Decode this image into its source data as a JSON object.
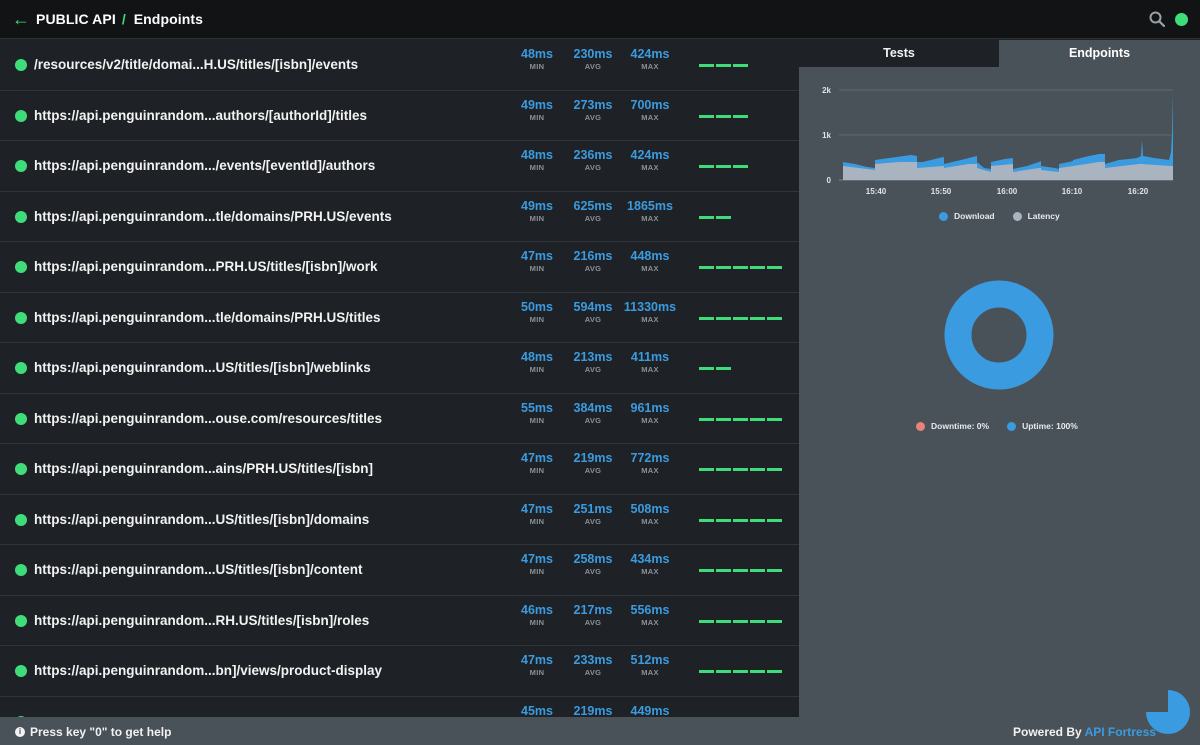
{
  "header": {
    "breadcrumb_root": "PUBLIC API",
    "separator": "/",
    "breadcrumb_current": "Endpoints"
  },
  "metric_labels": {
    "min": "MIN",
    "avg": "AVG",
    "max": "MAX",
    "unit": "ms"
  },
  "endpoints": [
    {
      "url": "/resources/v2/title/domai...H.US/titles/[isbn]/events",
      "min": "48",
      "avg": "230",
      "max": "424",
      "bars": 3
    },
    {
      "url": "https://api.penguinrandom...authors/[authorId]/titles",
      "min": "49",
      "avg": "273",
      "max": "700",
      "bars": 3
    },
    {
      "url": "https://api.penguinrandom.../events/[eventId]/authors",
      "min": "48",
      "avg": "236",
      "max": "424",
      "bars": 3
    },
    {
      "url": "https://api.penguinrandom...tle/domains/PRH.US/events",
      "min": "49",
      "avg": "625",
      "max": "1865",
      "bars": 2
    },
    {
      "url": "https://api.penguinrandom...PRH.US/titles/[isbn]/work",
      "min": "47",
      "avg": "216",
      "max": "448",
      "bars": 5
    },
    {
      "url": "https://api.penguinrandom...tle/domains/PRH.US/titles",
      "min": "50",
      "avg": "594",
      "max": "11330",
      "bars": 5
    },
    {
      "url": "https://api.penguinrandom...US/titles/[isbn]/weblinks",
      "min": "48",
      "avg": "213",
      "max": "411",
      "bars": 2
    },
    {
      "url": "https://api.penguinrandom...ouse.com/resources/titles",
      "min": "55",
      "avg": "384",
      "max": "961",
      "bars": 5
    },
    {
      "url": "https://api.penguinrandom...ains/PRH.US/titles/[isbn]",
      "min": "47",
      "avg": "219",
      "max": "772",
      "bars": 5
    },
    {
      "url": "https://api.penguinrandom...US/titles/[isbn]/domains",
      "min": "47",
      "avg": "251",
      "max": "508",
      "bars": 5
    },
    {
      "url": "https://api.penguinrandom...US/titles/[isbn]/content",
      "min": "47",
      "avg": "258",
      "max": "434",
      "bars": 5
    },
    {
      "url": "https://api.penguinrandom...RH.US/titles/[isbn]/roles",
      "min": "46",
      "avg": "217",
      "max": "556",
      "bars": 5
    },
    {
      "url": "https://api.penguinrandom...bn]/views/product-display",
      "min": "47",
      "avg": "233",
      "max": "512",
      "bars": 5
    },
    {
      "url": "",
      "min": "45",
      "avg": "219",
      "max": "449",
      "bars": 0
    }
  ],
  "tabs": {
    "tests": "Tests",
    "endpoints": "Endpoints",
    "active": "Endpoints"
  },
  "chart_data": [
    {
      "type": "area",
      "y_ticks": [
        "0",
        "1k",
        "2k"
      ],
      "ylim": [
        0,
        2000
      ],
      "x_ticks": [
        "15:40",
        "15:50",
        "16:00",
        "16:10",
        "16:20"
      ],
      "grid": true,
      "legend_position": "bottom",
      "series": [
        {
          "name": "Download",
          "color": "#3b9be0"
        },
        {
          "name": "Latency",
          "color": "#aab4c0"
        }
      ]
    },
    {
      "type": "pie",
      "donut": true,
      "legend_position": "bottom",
      "slices": [
        {
          "label": "Downtime: 0%",
          "value": 0,
          "color": "#e8837a"
        },
        {
          "label": "Uptime: 100%",
          "value": 100,
          "color": "#3b9be0"
        }
      ]
    }
  ],
  "footer": {
    "help": "Press key \"0\" to get help",
    "powered_prefix": "Powered By",
    "powered_brand": "API Fortress"
  },
  "colors": {
    "green": "#3fdc7a",
    "blue": "#3b9be0",
    "panel": "#4a5259",
    "bg": "#1e2226"
  }
}
